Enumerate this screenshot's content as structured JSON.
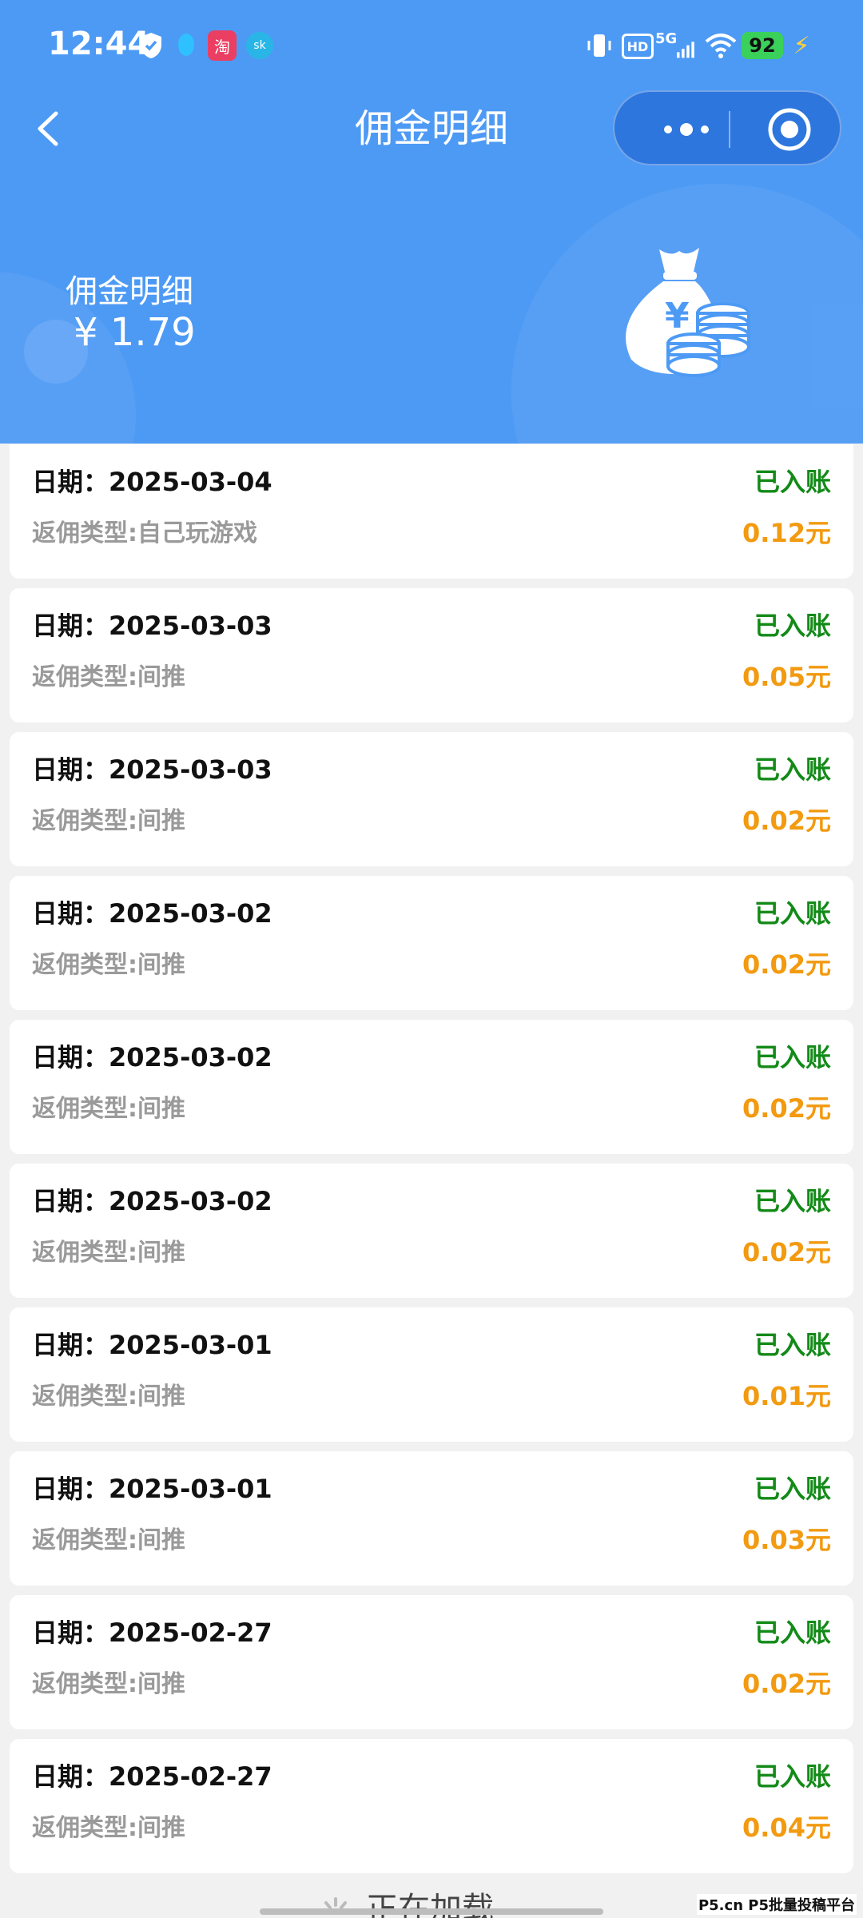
{
  "status_bar": {
    "time": "12:44",
    "battery": "92",
    "network": "5G",
    "hd": "HD"
  },
  "nav": {
    "title": "佣金明细"
  },
  "balance": {
    "label": "佣金明细",
    "value": "¥ 1.79"
  },
  "records": [
    {
      "date": "日期：2025-03-04",
      "type": "返佣类型:自己玩游戏",
      "status": "已入账",
      "amount": "0.12元"
    },
    {
      "date": "日期：2025-03-03",
      "type": "返佣类型:间推",
      "status": "已入账",
      "amount": "0.05元"
    },
    {
      "date": "日期：2025-03-03",
      "type": "返佣类型:间推",
      "status": "已入账",
      "amount": "0.02元"
    },
    {
      "date": "日期：2025-03-02",
      "type": "返佣类型:间推",
      "status": "已入账",
      "amount": "0.02元"
    },
    {
      "date": "日期：2025-03-02",
      "type": "返佣类型:间推",
      "status": "已入账",
      "amount": "0.02元"
    },
    {
      "date": "日期：2025-03-02",
      "type": "返佣类型:间推",
      "status": "已入账",
      "amount": "0.02元"
    },
    {
      "date": "日期：2025-03-01",
      "type": "返佣类型:间推",
      "status": "已入账",
      "amount": "0.01元"
    },
    {
      "date": "日期：2025-03-01",
      "type": "返佣类型:间推",
      "status": "已入账",
      "amount": "0.03元"
    },
    {
      "date": "日期：2025-02-27",
      "type": "返佣类型:间推",
      "status": "已入账",
      "amount": "0.02元"
    },
    {
      "date": "日期：2025-02-27",
      "type": "返佣类型:间推",
      "status": "已入账",
      "amount": "0.04元"
    }
  ],
  "loading_text": "正在加载",
  "watermark": "P5.cn P5批量投稿平台",
  "colors": {
    "header_bg": "#4d9af5",
    "status_ok": "#138a18",
    "amount": "#f29a10",
    "type_text": "#9a9a9a"
  }
}
